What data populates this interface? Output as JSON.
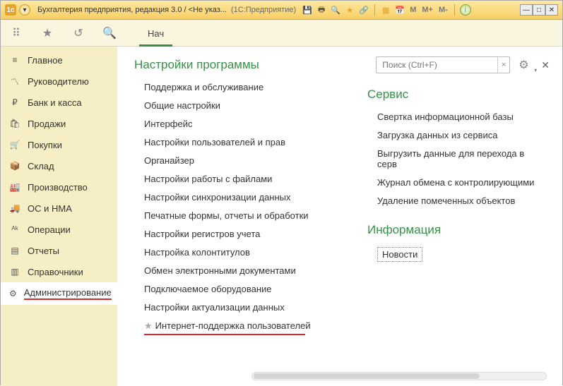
{
  "titlebar": {
    "title": "Бухгалтерия предприятия, редакция 3.0 / <Не указ...",
    "app": "(1С:Предприятие)"
  },
  "toolbar2": {
    "tab1": "Нач"
  },
  "sidebar": {
    "items": [
      {
        "label": "Главное"
      },
      {
        "label": "Руководителю"
      },
      {
        "label": "Банк и касса"
      },
      {
        "label": "Продажи"
      },
      {
        "label": "Покупки"
      },
      {
        "label": "Склад"
      },
      {
        "label": "Производство"
      },
      {
        "label": "ОС и НМА"
      },
      {
        "label": "Операции"
      },
      {
        "label": "Отчеты"
      },
      {
        "label": "Справочники"
      },
      {
        "label": "Администрирование"
      }
    ]
  },
  "panel": {
    "search_placeholder": "Поиск (Ctrl+F)",
    "settings_h": "Настройки программы",
    "settings": [
      "Поддержка и обслуживание",
      "Общие настройки",
      "Интерфейс",
      "Настройки пользователей и прав",
      "Органайзер",
      "Настройки работы с файлами",
      "Настройки синхронизации данных",
      "Печатные формы, отчеты и обработки",
      "Настройки регистров учета",
      "Настройка колонтитулов",
      "Обмен электронными документами",
      "Подключаемое оборудование",
      "Настройки актуализации данных"
    ],
    "starred": "Интернет-поддержка пользователей",
    "service_h": "Сервис",
    "service": [
      "Свертка информационной базы",
      "Загрузка данных из сервиса",
      "Выгрузить данные для перехода в серв",
      "Журнал обмена с контролирующими",
      "Удаление помеченных объектов"
    ],
    "info_h": "Информация",
    "news": "Новости"
  }
}
